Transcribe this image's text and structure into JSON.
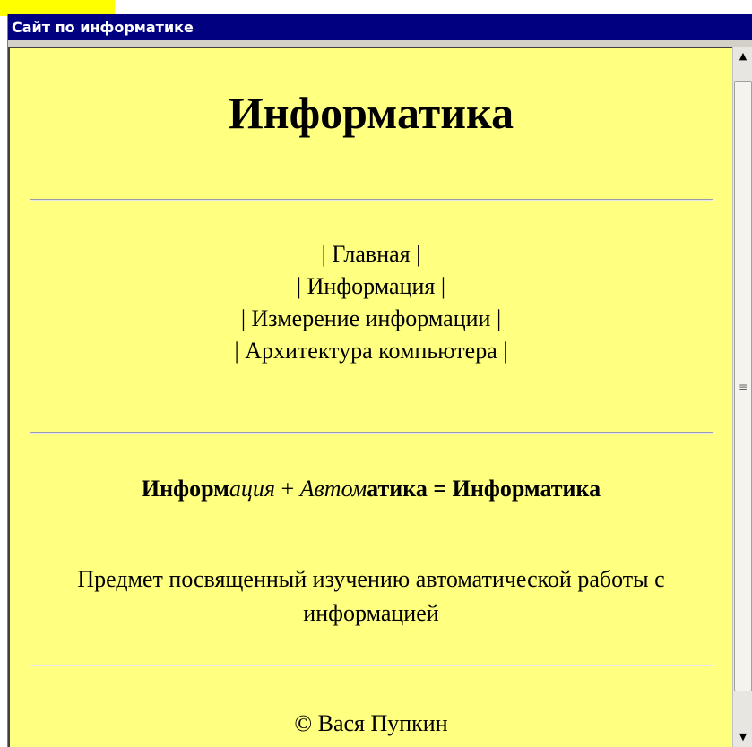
{
  "window": {
    "title": "Сайт по информатике"
  },
  "page": {
    "heading": "Информатика",
    "nav": [
      "| Главная |",
      "| Информация |",
      "| Измерение информации |",
      "| Архитектура компьютера |"
    ],
    "formula": {
      "part1_bold": "Информ",
      "part1_italic": "ация",
      "plus": " + ",
      "part2_italic": "Автом",
      "part2_bold": "атика",
      "result": " = Информатика"
    },
    "description": "Предмет посвященный изучению автоматической работы с информацией",
    "footer": "© Вася Пупкин"
  },
  "scrollbar": {
    "up_icon": "arrow-up-icon",
    "down_icon": "arrow-down-icon",
    "grip_icon": "scroll-grip-icon"
  },
  "colors": {
    "titlebar": "#000080",
    "page_background": "#ffff80",
    "highlight": "#ffff00"
  }
}
